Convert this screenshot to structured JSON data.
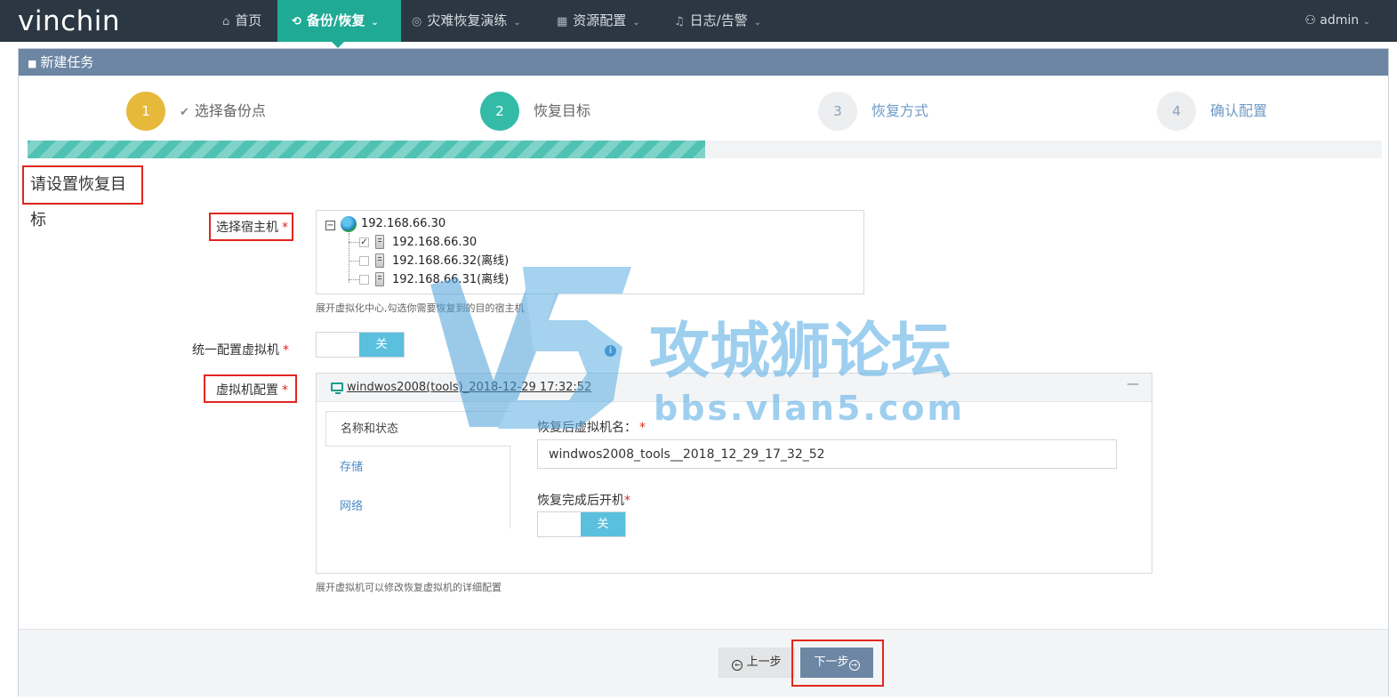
{
  "app": {
    "logo": "vinchin"
  },
  "nav": {
    "items": [
      {
        "label": "首页",
        "icon": "home-icon",
        "glyph": "⌂"
      },
      {
        "label": "备份/恢复",
        "icon": "sync-icon",
        "glyph": "⟲",
        "active": true
      },
      {
        "label": "灾难恢复演练",
        "icon": "drill-icon",
        "glyph": "◎"
      },
      {
        "label": "资源配置",
        "icon": "grid-icon",
        "glyph": "▦"
      },
      {
        "label": "日志/告警",
        "icon": "bell-icon",
        "glyph": "♫"
      }
    ],
    "chevron": "⌄",
    "user": {
      "icon_glyph": "⚇",
      "name": "admin",
      "chevron": "⌄"
    }
  },
  "panel": {
    "title": "新建任务",
    "icon_glyph": "■"
  },
  "steps": [
    {
      "num": "1",
      "label": "选择备份点",
      "state": "done",
      "check": "✔"
    },
    {
      "num": "2",
      "label": "恢复目标",
      "state": "current"
    },
    {
      "num": "3",
      "label": "恢复方式",
      "state": "todo"
    },
    {
      "num": "4",
      "label": "确认配置",
      "state": "todo"
    }
  ],
  "progress_percent": 50,
  "section_title": "请设置恢复目标",
  "host": {
    "label": "选择宿主机",
    "required_mark": "*",
    "root": "192.168.66.30",
    "expander": "−",
    "nodes": [
      {
        "label": "192.168.66.30",
        "checked": true
      },
      {
        "label": "192.168.66.32(离线)",
        "checked": false
      },
      {
        "label": "192.168.66.31(离线)",
        "checked": false
      }
    ],
    "check_glyph": "✓",
    "help": "展开虚拟化中心,勾选你需要恢复到的目的宿主机"
  },
  "unify": {
    "label": "统一配置虚拟机",
    "required_mark": "*",
    "toggle_text": "关",
    "info_glyph": "i"
  },
  "vm": {
    "label": "虚拟机配置",
    "required_mark": "*",
    "title": "windwos2008(tools)_2018-12-29 17:32:52",
    "collapse": "—",
    "tabs": [
      "名称和状态",
      "存储",
      "网络"
    ],
    "name_label": "恢复后虚拟机名：",
    "name_value": "windwos2008_tools__2018_12_29_17_32_52",
    "poweron_label": "恢复完成后开机",
    "toggle_text": "关",
    "help": "展开虚拟机可以修改恢复虚拟机的详细配置"
  },
  "footer": {
    "prev": "上一步",
    "prev_glyph": "←",
    "next": "下一步",
    "next_glyph": "→"
  },
  "watermark": {
    "title": "攻城狮论坛",
    "url": "bbs.vlan5.com"
  },
  "colors": {
    "nav_bg": "#2b3742",
    "accent": "#1faa96",
    "panel_head": "#6c86a4",
    "highlight": "#e0261f"
  }
}
